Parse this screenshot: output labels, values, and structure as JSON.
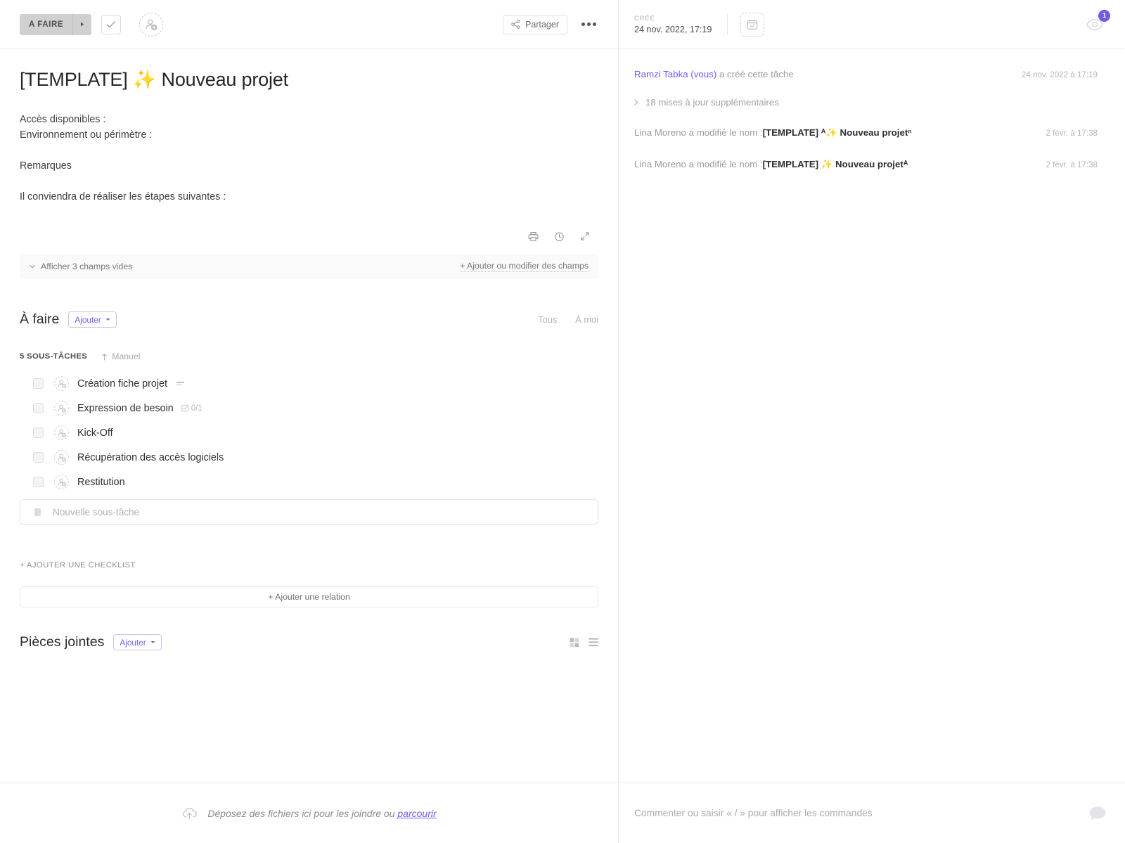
{
  "header": {
    "status_label": "A FAIRE",
    "status_arrow_icon": "caret-right-icon",
    "complete_icon": "check-icon",
    "assignee_icon": "user-add-icon",
    "share_label": "Partager",
    "share_icon": "share-nodes-icon",
    "more_icon": "ellipsis-icon"
  },
  "task": {
    "title": "[TEMPLATE] ✨ Nouveau projet",
    "description_lines": [
      "Accès disponibles :",
      "Environnement ou périmètre :",
      "Remarques",
      "Il conviendra de réaliser les étapes suivantes :"
    ],
    "tools": {
      "print_icon": "printer-icon",
      "history_icon": "clock-history-icon",
      "expand_icon": "expand-icon"
    }
  },
  "fields_bar": {
    "toggle_icon": "chevron-down-icon",
    "show_empty_label": "Afficher 3 champs vides",
    "edit_fields_label": "+ Ajouter ou modifier des champs"
  },
  "todo_section": {
    "title": "À faire",
    "add_label": "Ajouter",
    "add_caret_icon": "caret-down-icon",
    "tabs": [
      {
        "label": "Tous"
      },
      {
        "label": "À moi"
      }
    ],
    "count_label": "5 SOUS-TÂCHES",
    "sort_icon": "arrow-up-icon",
    "sort_label": "Manuel",
    "subtasks": [
      {
        "name": "Création fiche projet",
        "checkbox_icon": "checkbox-icon",
        "assignee_icon": "user-add-icon",
        "has_description": true,
        "checklist": null
      },
      {
        "name": "Expression de besoin",
        "checkbox_icon": "checkbox-icon",
        "assignee_icon": "user-add-icon",
        "has_description": false,
        "checklist": "0/1"
      },
      {
        "name": "Kick-Off",
        "checkbox_icon": "checkbox-icon",
        "assignee_icon": "user-add-icon",
        "has_description": false,
        "checklist": null
      },
      {
        "name": "Récupération des accès logiciels",
        "checkbox_icon": "checkbox-icon",
        "assignee_icon": "user-add-icon",
        "has_description": false,
        "checklist": null
      },
      {
        "name": "Restitution",
        "checkbox_icon": "checkbox-icon",
        "assignee_icon": "user-add-icon",
        "has_description": false,
        "checklist": null
      }
    ],
    "new_subtask_placeholder": "Nouvelle sous-tâche",
    "add_checklist_label": "+ AJOUTER UNE CHECKLIST",
    "add_relation_label": "+ Ajouter une relation"
  },
  "attachments": {
    "title": "Pièces jointes",
    "add_label": "Ajouter",
    "add_caret_icon": "caret-down-icon",
    "grid_view_icon": "grid-view-icon",
    "list_view_icon": "list-view-icon"
  },
  "right_header": {
    "created_label": "CRÉÉ",
    "created_value": "24 nov. 2022, 17:19",
    "date_icon": "calendar-check-icon",
    "watch_icon": "eye-icon",
    "watch_count": "1"
  },
  "activity": {
    "entries": [
      {
        "user": "Ramzi Tabka (vous)",
        "action": " a créé cette tâche",
        "time": "24 nov. 2022 à 17:19"
      },
      {
        "user": "Lina Moreno",
        "action": " a modifié le nom :",
        "value": "[TEMPLATE] ᴬ✨ Nouveau projetⁿ",
        "time": "2 févr. à 17:38"
      },
      {
        "user": "Lina Moreno",
        "action": " a modifié le nom :",
        "value": "[TEMPLATE] ✨ Nouveau projetᴬ",
        "time": "2 févr. à 17:38"
      }
    ],
    "more_updates_label": "18 mises à jour supplémentaires",
    "more_updates_icon": "chevron-right-icon"
  },
  "footer": {
    "drop_icon": "cloud-upload-icon",
    "drop_text": "Déposez des fichiers ici pour les joindre ou ",
    "drop_link": "parcourir",
    "comment_placeholder": "Commenter ou saisir « / » pour afficher les commandes",
    "chat_icon": "chat-bubble-icon"
  },
  "colors": {
    "accent": "#6a61e8",
    "badge": "#6c5ce7",
    "status_bg": "#d0d0d0"
  }
}
